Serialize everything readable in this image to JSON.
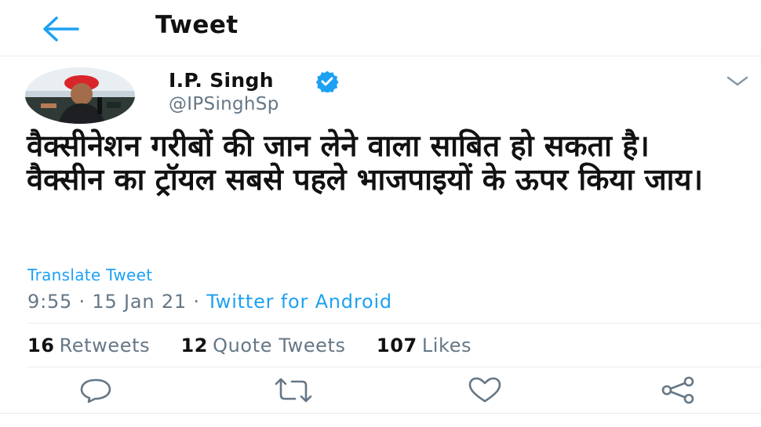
{
  "header": {
    "title": "Tweet"
  },
  "author": {
    "name": "I.P. Singh",
    "handle": "@IPSinghSp"
  },
  "tweet": {
    "lines": [
      "वैक्सीनेशन गरीबों की जान लेने वाला साबित हो सकता है।",
      "वैक्सीन का ट्रॉयल सबसे पहले भाजपाइयों के ऊपर किया जाय।"
    ],
    "translate_label": "Translate Tweet",
    "time": "9:55",
    "date": "15 Jan 21",
    "separator": "·",
    "source": "Twitter for Android"
  },
  "stats": {
    "retweets": {
      "count": "16",
      "label": "Retweets"
    },
    "quotes": {
      "count": "12",
      "label": "Quote Tweets"
    },
    "likes": {
      "count": "107",
      "label": "Likes"
    }
  },
  "colors": {
    "accent": "#1da1f2",
    "text": "#14171a",
    "muted": "#657786",
    "divider": "#e6ecf0"
  },
  "icons": [
    "back-arrow-icon",
    "verified-badge-icon",
    "chevron-down-icon",
    "reply-icon",
    "retweet-icon",
    "like-icon",
    "share-icon"
  ]
}
